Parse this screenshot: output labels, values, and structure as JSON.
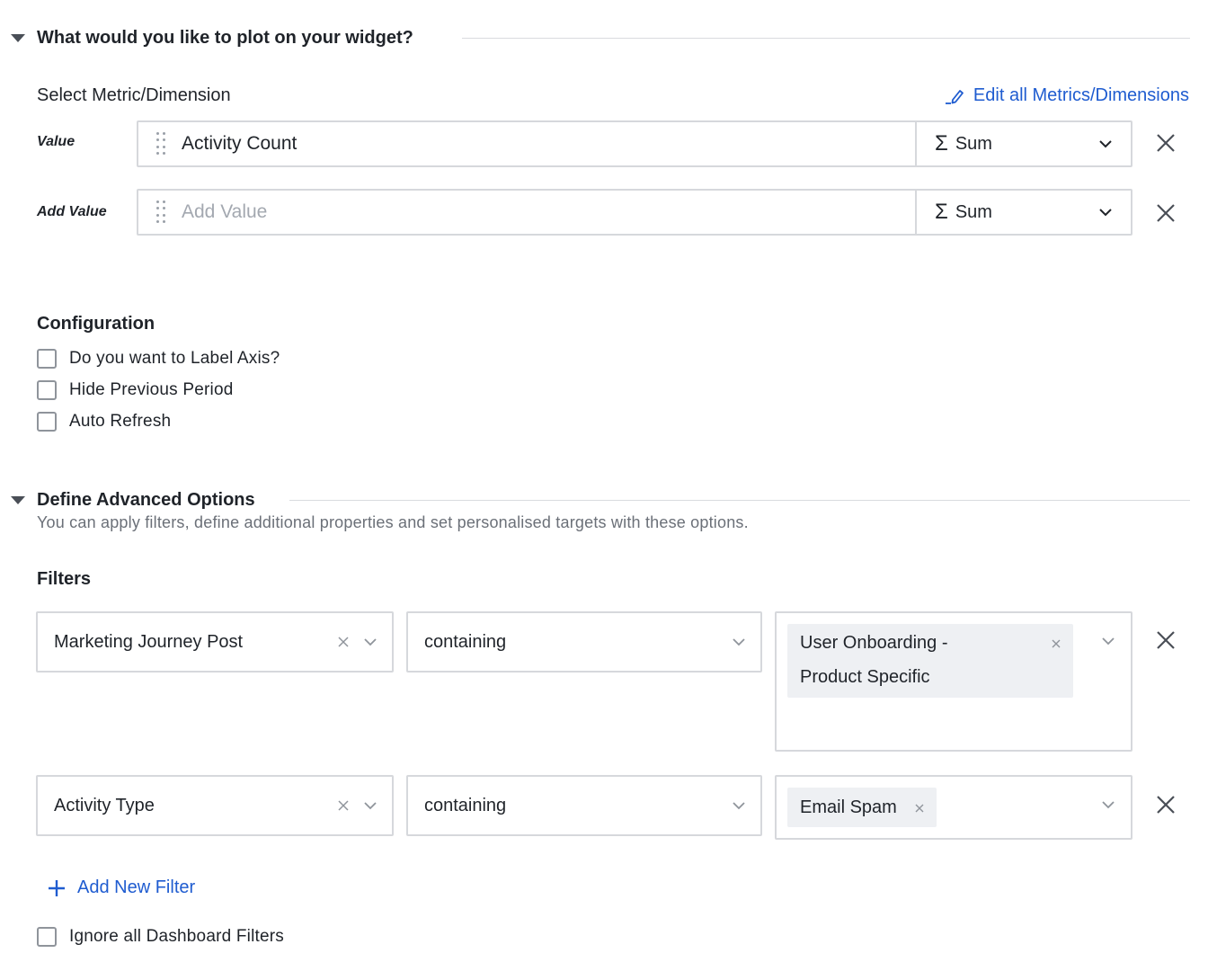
{
  "plot_section": {
    "title": "What would you like to plot on your widget?",
    "select_label": "Select Metric/Dimension",
    "edit_link": "Edit all Metrics/Dimensions",
    "rows": [
      {
        "label": "Value",
        "value": "Activity Count",
        "aggregation": "Sum"
      },
      {
        "label": "Add Value",
        "placeholder": "Add Value",
        "aggregation": "Sum"
      }
    ]
  },
  "configuration": {
    "title": "Configuration",
    "options": [
      {
        "label": "Do you want to Label Axis?",
        "checked": false
      },
      {
        "label": "Hide Previous Period",
        "checked": false
      },
      {
        "label": "Auto Refresh",
        "checked": false
      }
    ]
  },
  "advanced": {
    "title": "Define Advanced Options",
    "subtitle": "You can apply filters, define additional properties and set personalised targets with these options."
  },
  "filters": {
    "title": "Filters",
    "rows": [
      {
        "field": "Marketing Journey Post",
        "operator": "containing",
        "values": [
          "User Onboarding - Product Specific"
        ],
        "value_lines": [
          "User Onboarding -",
          "Product Specific"
        ]
      },
      {
        "field": "Activity Type",
        "operator": "containing",
        "values": [
          "Email Spam"
        ]
      }
    ],
    "add_label": "Add New Filter",
    "ignore_label": "Ignore all Dashboard Filters"
  },
  "colors": {
    "accent": "#1f5cd0",
    "border": "#d6d8dc",
    "tag_bg": "#eef0f3"
  }
}
